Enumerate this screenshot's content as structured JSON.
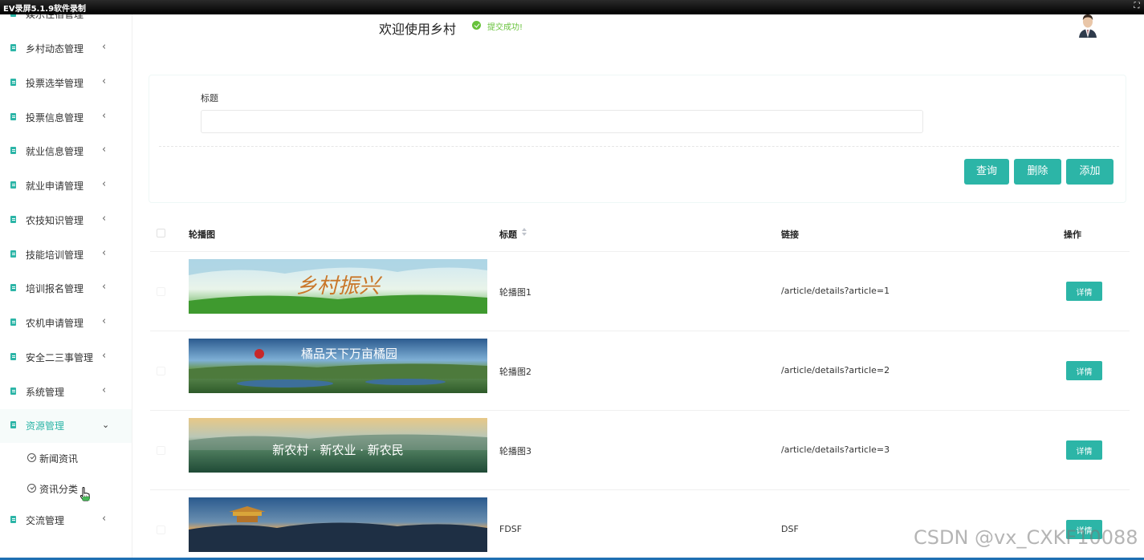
{
  "recorder": {
    "title": "EV录屏5.1.9软件录制"
  },
  "header": {
    "welcome": "欢迎使用乡村",
    "toast": "提交成功!"
  },
  "sidebar": {
    "items": [
      {
        "label": "娱乐住宿管理"
      },
      {
        "label": "乡村动态管理"
      },
      {
        "label": "投票选举管理"
      },
      {
        "label": "投票信息管理"
      },
      {
        "label": "就业信息管理"
      },
      {
        "label": "就业申请管理"
      },
      {
        "label": "农技知识管理"
      },
      {
        "label": "技能培训管理"
      },
      {
        "label": "培训报名管理"
      },
      {
        "label": "农机申请管理"
      },
      {
        "label": "安全二三事管理"
      },
      {
        "label": "系统管理"
      },
      {
        "label": "资源管理"
      },
      {
        "label": "交流管理"
      }
    ],
    "sub_items": [
      {
        "label": "新闻资讯"
      },
      {
        "label": "资讯分类"
      }
    ]
  },
  "search": {
    "label": "标题",
    "value": "",
    "placeholder": ""
  },
  "buttons": {
    "query": "查询",
    "delete": "删除",
    "add": "添加"
  },
  "table": {
    "columns": [
      "轮播图",
      "标题",
      "链接",
      "操作"
    ],
    "action_label": "详情",
    "rows": [
      {
        "banner_text": "乡村振兴",
        "title": "轮播图1",
        "link": "/article/details?article=1"
      },
      {
        "banner_text": "橘品天下万亩橘园",
        "title": "轮播图2",
        "link": "/article/details?article=2"
      },
      {
        "banner_text": "新农村 · 新农业 · 新农民",
        "title": "轮播图3",
        "link": "/article/details?article=3"
      },
      {
        "banner_text": "",
        "title": "FDSF",
        "link": "DSF"
      }
    ]
  },
  "watermark": "CSDN @vx_CXKF10088",
  "colors": {
    "accent": "#2cb5a7",
    "success": "#67c23a"
  }
}
